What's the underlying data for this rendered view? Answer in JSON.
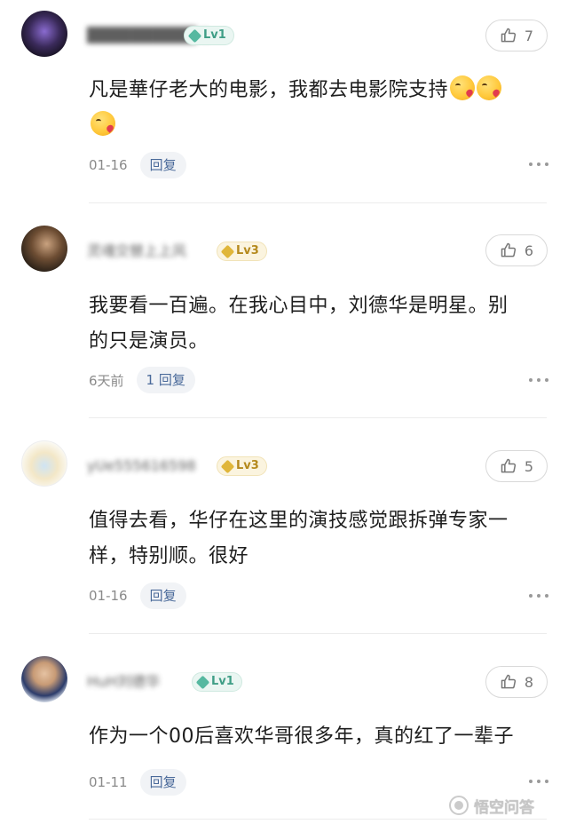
{
  "comments": [
    {
      "username": "██████████毛",
      "level": "Lv1",
      "likes": "7",
      "content_lines": [
        "凡是華仔老大的电影，我都去电影院支持",
        ""
      ],
      "date": "01-16",
      "reply_label": "回复"
    },
    {
      "username": "灵魂交替上上风",
      "level": "Lv3",
      "likes": "6",
      "content_lines": [
        "我要看一百遍。在我心目中，刘德华是明星。别",
        "的只是演员。"
      ],
      "date": "6天前",
      "reply_label": "1 回复"
    },
    {
      "username": "yUe555616598",
      "level": "Lv3",
      "likes": "5",
      "content_lines": [
        "值得去看，华仔在这里的演技感觉跟拆弹专家一",
        "样，特别顺。很好"
      ],
      "date": "01-16",
      "reply_label": "回复"
    },
    {
      "username": "HuH刘德华",
      "level": "Lv1",
      "likes": "8",
      "content_lines": [
        "作为一个00后喜欢华哥很多年，真的红了一辈子"
      ],
      "date": "01-11",
      "reply_label": "回复"
    }
  ],
  "icons": {
    "like": "thumbs-up-icon",
    "more": "more-dots-icon",
    "emoji": "kissing-heart-emoji"
  },
  "watermark": "悟空问答",
  "colors": {
    "lv1": "#3f9e86",
    "lv3": "#b58a1e",
    "reply": "#4a6a9a"
  }
}
